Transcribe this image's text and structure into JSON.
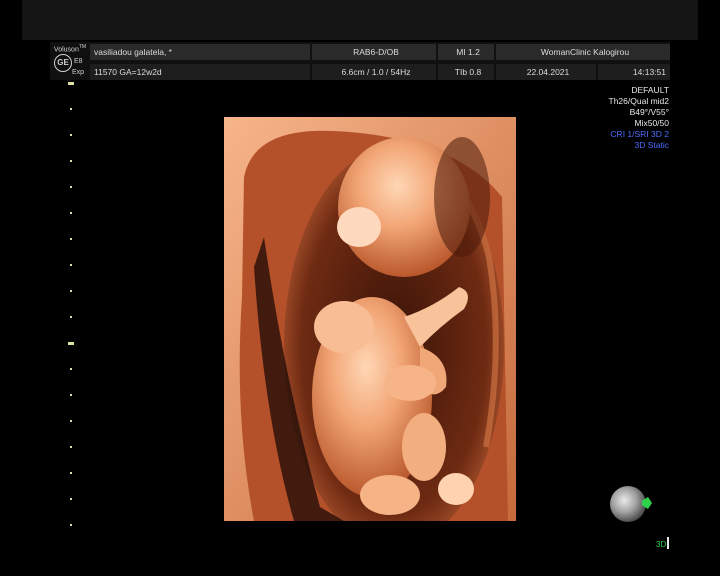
{
  "header": {
    "brand": "Voluson",
    "brand_sup": "TM",
    "logo_text": "GE",
    "sub1": "E8",
    "sub2": "Exp",
    "patient_name": "vasiliadou galatela,  *",
    "probe": "RAB6-D/OB",
    "mi": "MI  1.2",
    "clinic": "WomanClinic Kalogirou",
    "patient_id": "11570  GA=12w2d",
    "depth": "6.6cm / 1.0 / 54Hz",
    "tib": "TIb  0.8",
    "date": "22.04.2021",
    "time": "14:13:51"
  },
  "settings": {
    "lines": [
      "DEFAULT",
      "Th26/Qual mid2",
      "B49°/V55°",
      "Mix50/50"
    ],
    "blue_lines": [
      "CRI 1/SRI 3D 2",
      "3D Static"
    ]
  },
  "scale": {
    "tick_count": 18,
    "major_ticks": [
      0,
      10
    ]
  },
  "render": {
    "description_icon": "fetus-3d-render"
  },
  "orientation": {
    "mode_label": "3D"
  },
  "colors": {
    "background": "#000000",
    "header_bg": "#2a2a2a",
    "blue_text": "#4f6cff",
    "orientation_green": "#2fd04a",
    "render_light": "#f0a070",
    "render_dark": "#8a3a1c"
  }
}
